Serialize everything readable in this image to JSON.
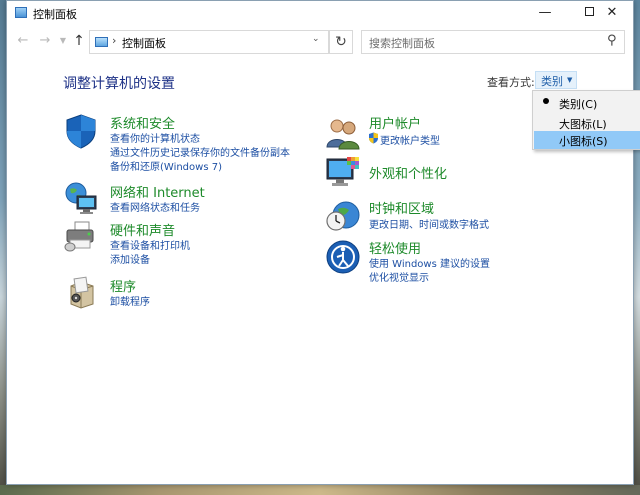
{
  "window": {
    "title": "控制面板",
    "controls": {
      "minimize": "—",
      "close": "✕"
    }
  },
  "nav": {
    "address": "控制面板",
    "search_placeholder": "搜索控制面板"
  },
  "content": {
    "heading": "调整计算机的设置",
    "view_by_label": "查看方式:",
    "view_by_value": "类别"
  },
  "view_menu": {
    "options": [
      "类别(C)",
      "大图标(L)",
      "小图标(S)"
    ],
    "selected": "类别(C)",
    "highlighted": "小图标(S)"
  },
  "categories_left": [
    {
      "title": "系统和安全",
      "links": [
        "查看你的计算机状态",
        "通过文件历史记录保存你的文件备份副本",
        "备份和还原(Windows 7)"
      ]
    },
    {
      "title": "网络和 Internet",
      "links": [
        "查看网络状态和任务"
      ]
    },
    {
      "title": "硬件和声音",
      "links": [
        "查看设备和打印机",
        "添加设备"
      ]
    },
    {
      "title": "程序",
      "links": [
        "卸载程序"
      ]
    }
  ],
  "categories_right": [
    {
      "title": "用户帐户",
      "links": [
        "更改帐户类型"
      ]
    },
    {
      "title": "外观和个性化",
      "links": []
    },
    {
      "title": "时钟和区域",
      "links": [
        "更改日期、时间或数字格式"
      ]
    },
    {
      "title": "轻松使用",
      "links": [
        "使用 Windows 建议的设置",
        "优化视觉显示"
      ]
    }
  ],
  "icons": {
    "app": "control-panel-icon",
    "system_security": "shield-icon",
    "network": "network-globe-icon",
    "hardware": "printer-icon",
    "programs": "programs-box-icon",
    "user_accounts": "users-icon",
    "appearance": "monitor-palette-icon",
    "clock": "clock-globe-icon",
    "ease_of_access": "ease-of-access-icon"
  },
  "colors": {
    "category_title": "#1d8a2a",
    "link": "#1d4fa3",
    "heading": "#1e3287",
    "menu_highlight": "#91c9f7"
  }
}
